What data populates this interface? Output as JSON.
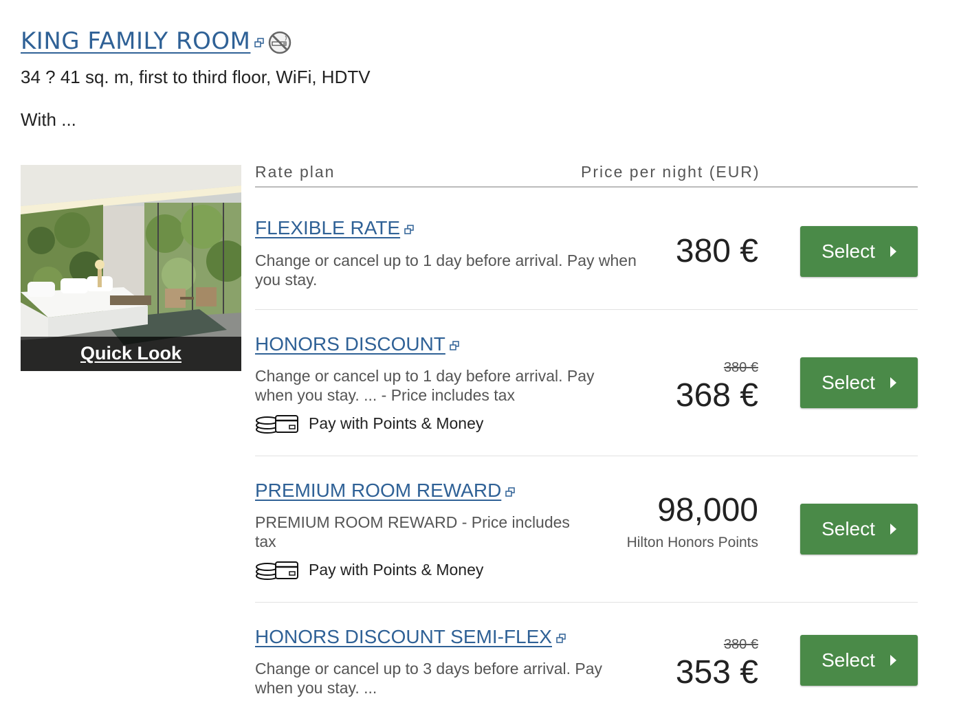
{
  "room": {
    "title": "KING FAMILY ROOM",
    "description": "34 ? 41 sq. m, first to third floor, WiFi, HDTV",
    "with_text": "With ...",
    "quick_look": "Quick Look"
  },
  "table": {
    "col_rate_plan": "Rate plan",
    "col_price": "Price per night (EUR)"
  },
  "rates": [
    {
      "name": "FLEXIBLE RATE",
      "desc_line1": "Change or cancel up to 1 day before arrival. Pay when",
      "desc_line2": "you stay.",
      "price": "380 €",
      "select": "Select"
    },
    {
      "name": "HONORS DISCOUNT",
      "desc_line1": "Change or cancel up to 1 day before arrival. Pay",
      "desc_line2": "when you stay. ... - Price includes tax",
      "pay_label": "Pay with Points & Money",
      "old_price": "380 €",
      "price": "368 €",
      "select": "Select"
    },
    {
      "name": "PREMIUM ROOM REWARD",
      "desc_line1": "PREMIUM ROOM REWARD - Price includes",
      "desc_line2": "tax",
      "pay_label": "Pay with Points & Money",
      "price": "98,000",
      "price_sub": "Hilton Honors Points",
      "select": "Select"
    },
    {
      "name": "HONORS DISCOUNT SEMI-FLEX",
      "desc_line1": "Change or cancel up to 3 days before arrival. Pay",
      "desc_line2": "when you stay. ...",
      "old_price": "380 €",
      "price": "353 €",
      "select": "Select"
    }
  ],
  "colors": {
    "link": "#2f6196",
    "select_button": "#4a8a48"
  }
}
